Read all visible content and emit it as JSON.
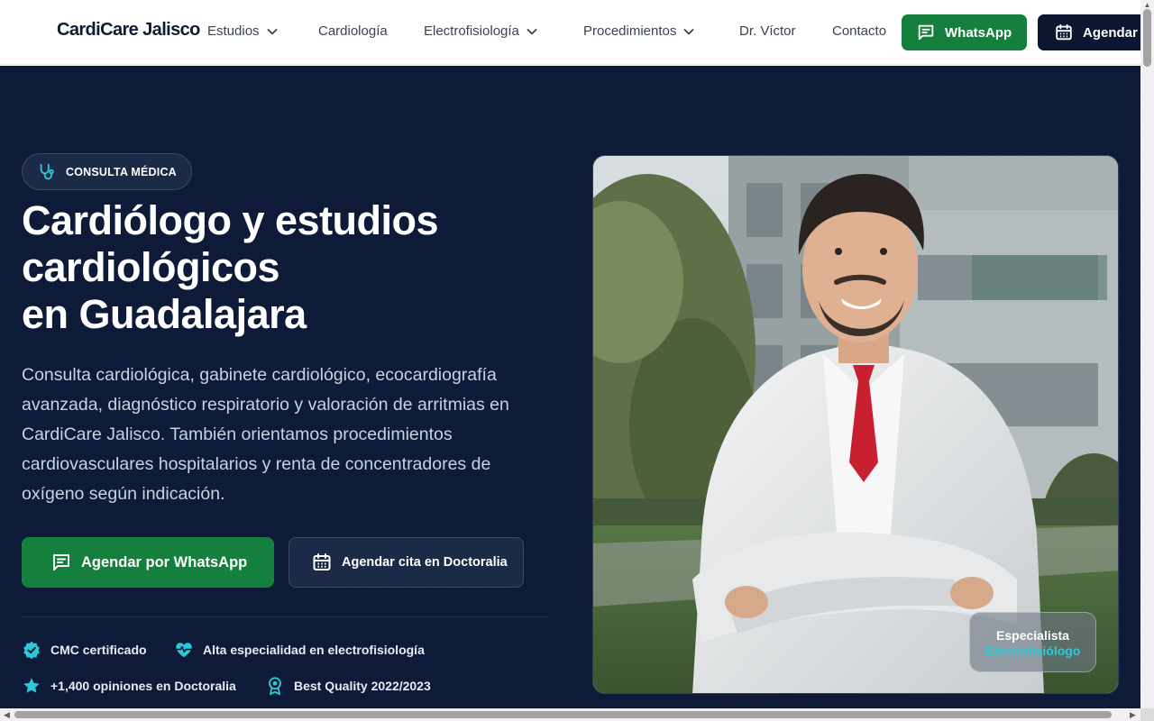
{
  "brand": {
    "name": "CardiCare Jalisco"
  },
  "nav": {
    "items": [
      {
        "label": "Estudios",
        "has_dropdown": true
      },
      {
        "label": "Cardiología",
        "has_dropdown": false
      },
      {
        "label": "Electrofisiología",
        "has_dropdown": true
      },
      {
        "label": "Procedimientos",
        "has_dropdown": true
      },
      {
        "label": "Dr. Víctor",
        "has_dropdown": false
      },
      {
        "label": "Contacto",
        "has_dropdown": false
      }
    ],
    "whatsapp_label": "WhatsApp",
    "agendar_label": "Agendar"
  },
  "hero": {
    "badge": "CONSULTA MÉDICA",
    "title_lines": [
      "Cardiólogo y estudios",
      "cardiológicos",
      "en Guadalajara"
    ],
    "lead": "Consulta cardiológica, gabinete cardiológico, ecocardiografía avanzada, diagnóstico respiratorio y valoración de arritmias en CardiCare Jalisco. También orientamos procedimientos cardiovasculares hospitalarios y renta de concentradores de oxígeno según indicación.",
    "cta_whatsapp": "Agendar por WhatsApp",
    "cta_doctoralia": "Agendar cita en Doctoralia",
    "features": [
      {
        "label": "CMC certificado",
        "icon": "verified-badge-icon"
      },
      {
        "label": "Alta especialidad en electrofisiología",
        "icon": "heart-pulse-icon"
      },
      {
        "label": "+1,400 opiniones en Doctoralia",
        "icon": "star-icon"
      },
      {
        "label": "Best Quality 2022/2023",
        "icon": "award-icon"
      }
    ],
    "photo_card": {
      "line1": "Especialista",
      "line2": "Electrofisiólogo"
    }
  },
  "colors": {
    "hero_bg": "#0d1b38",
    "whatsapp_green": "#15803d",
    "accent_teal": "#2dc9d6",
    "navy_button": "#0b1730"
  }
}
